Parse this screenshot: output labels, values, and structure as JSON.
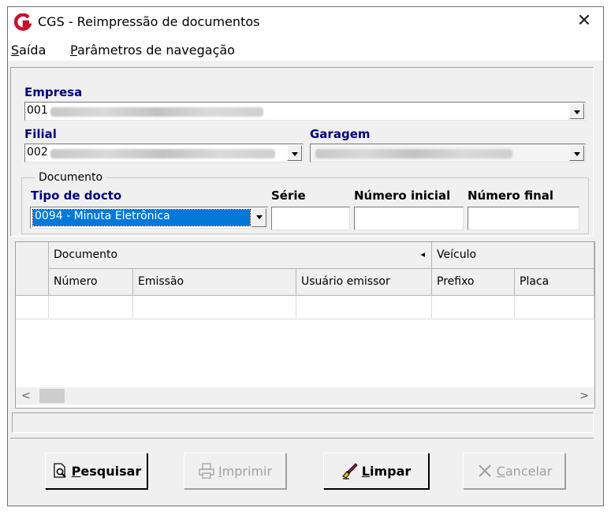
{
  "window": {
    "title": "CGS - Reimpressão de documentos",
    "close": "✕"
  },
  "menu": {
    "items": [
      {
        "first": "S",
        "rest": "aída"
      },
      {
        "first": "P",
        "rest": "arâmetros de navegação"
      }
    ]
  },
  "form": {
    "empresa_label": "Empresa",
    "empresa_value": "001",
    "filial_label": "Filial",
    "filial_value": "002",
    "garagem_label": "Garagem",
    "documento_group": "Documento",
    "tipo_label": "Tipo de docto",
    "tipo_value": "0094 - Minuta Eletrônica",
    "serie_label": "Série",
    "numero_inicial_label": "Número inicial",
    "numero_final_label": "Número final"
  },
  "grid": {
    "bands": [
      {
        "label": "Documento",
        "arrow": "◂"
      },
      {
        "label": "Veículo"
      }
    ],
    "columns": [
      "Número",
      "Emissão",
      "Usuário emissor",
      "Prefixo",
      "Placa"
    ],
    "scroll_left": "<",
    "scroll_right": ">"
  },
  "buttons": {
    "pesquisar": {
      "first": "P",
      "rest": "esquisar"
    },
    "imprimir": {
      "first": "I",
      "rest": "mprimir"
    },
    "limpar": {
      "first": "L",
      "rest": "impar"
    },
    "cancelar": {
      "first": "C",
      "rest": "ancelar"
    }
  },
  "colors": {
    "accent_red": "#c8102e",
    "label_blue": "#000080",
    "selection": "#0078d7"
  }
}
